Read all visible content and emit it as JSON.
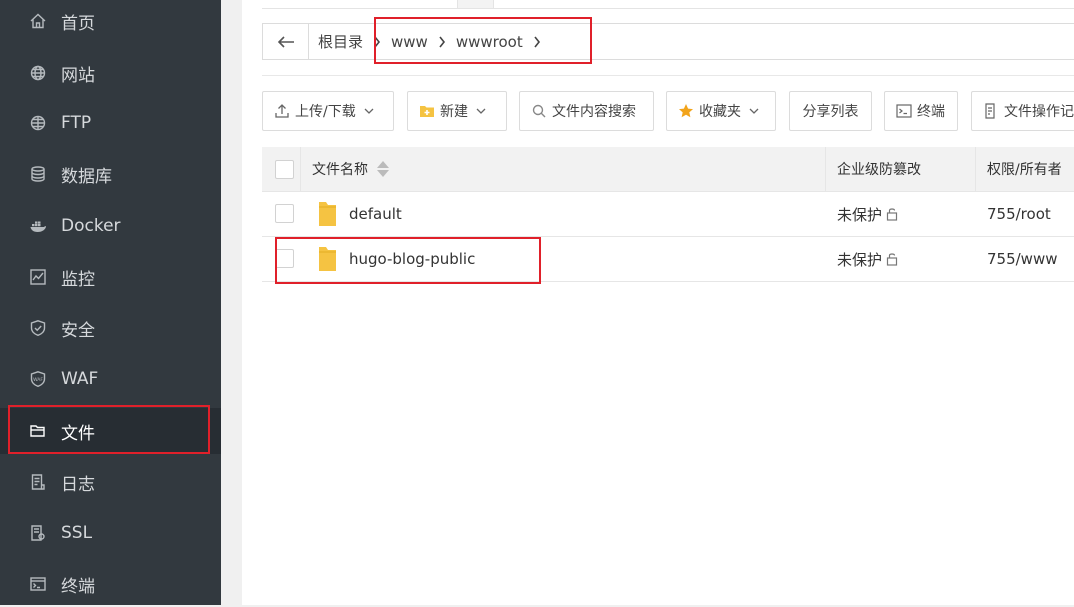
{
  "sidebar": {
    "items": [
      {
        "label": "首页",
        "icon": "home-icon"
      },
      {
        "label": "网站",
        "icon": "globe-icon"
      },
      {
        "label": "FTP",
        "icon": "ftp-globe-icon"
      },
      {
        "label": "数据库",
        "icon": "database-icon"
      },
      {
        "label": "Docker",
        "icon": "docker-icon"
      },
      {
        "label": "监控",
        "icon": "monitor-chart-icon"
      },
      {
        "label": "安全",
        "icon": "shield-icon"
      },
      {
        "label": "WAF",
        "icon": "waf-shield-icon"
      },
      {
        "label": "文件",
        "icon": "folder-icon",
        "active": true
      },
      {
        "label": "日志",
        "icon": "log-file-icon"
      },
      {
        "label": "SSL",
        "icon": "ssl-certificate-icon"
      },
      {
        "label": "终端",
        "icon": "terminal-icon"
      }
    ]
  },
  "breadcrumb": {
    "items": [
      "根目录",
      "www",
      "wwwroot"
    ]
  },
  "toolbar": {
    "upload_download": "上传/下载",
    "new": "新建",
    "content_search": "文件内容搜索",
    "favorites": "收藏夹",
    "share_list": "分享列表",
    "terminal": "终端",
    "file_ops": "文件操作记"
  },
  "table": {
    "headers": {
      "name": "文件名称",
      "tamper": "企业级防篡改",
      "perm": "权限/所有者"
    },
    "rows": [
      {
        "name": "default",
        "tamper": "未保护",
        "perm": "755/root"
      },
      {
        "name": "hugo-blog-public",
        "tamper": "未保护",
        "perm": "755/www"
      }
    ]
  },
  "colors": {
    "sidebar_bg": "#32393f",
    "highlight_red": "#e0202a",
    "folder_yellow": "#f5c342"
  }
}
